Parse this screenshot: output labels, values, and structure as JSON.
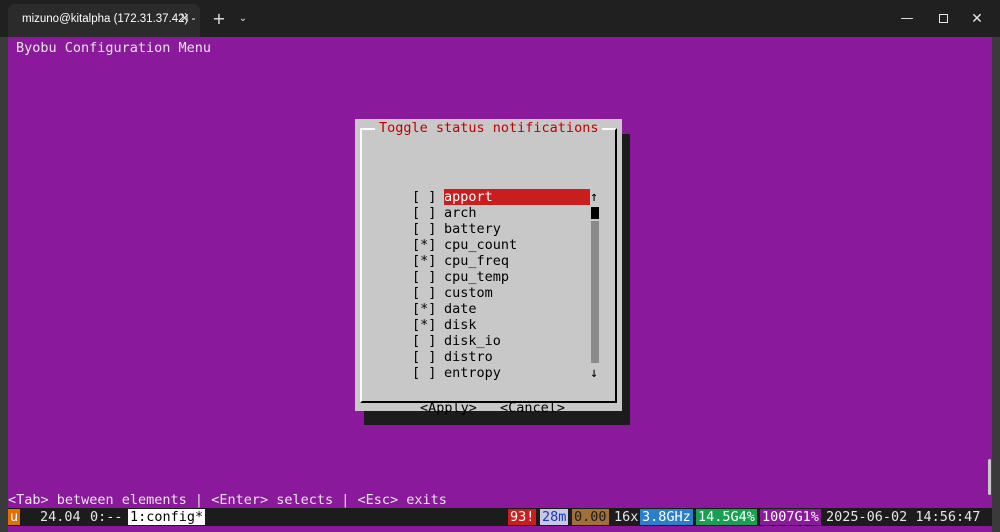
{
  "window": {
    "tab_title": "mizuno@kitalpha (172.31.37.42) -",
    "tab_close_icon": "×",
    "new_tab_icon": "+",
    "dropdown_icon": "⌄",
    "minimize_icon": "—",
    "close_icon": "✕"
  },
  "terminal": {
    "menu_title": "Byobu Configuration Menu",
    "dialog": {
      "title": "Toggle status notifications",
      "items": [
        {
          "check": "[ ]",
          "label": "apport",
          "selected": true
        },
        {
          "check": "[ ]",
          "label": "arch"
        },
        {
          "check": "[ ]",
          "label": "battery"
        },
        {
          "check": "[*]",
          "label": "cpu_count"
        },
        {
          "check": "[*]",
          "label": "cpu_freq"
        },
        {
          "check": "[ ]",
          "label": "cpu_temp"
        },
        {
          "check": "[ ]",
          "label": "custom"
        },
        {
          "check": "[*]",
          "label": "date"
        },
        {
          "check": "[*]",
          "label": "disk"
        },
        {
          "check": "[ ]",
          "label": "disk_io"
        },
        {
          "check": "[ ]",
          "label": "distro"
        },
        {
          "check": "[ ]",
          "label": "entropy"
        }
      ],
      "scroll_up": "↑",
      "scroll_down": "↓",
      "apply_label": "<Apply>",
      "cancel_label": "<Cancel>"
    },
    "help_line": "<Tab> between elements | <Enter> selects | <Esc> exits"
  },
  "statusbar": {
    "segments": [
      {
        "text": "u",
        "bg": "#e07000",
        "fg": "#ffffff"
      },
      {
        "text": "24.04",
        "bg": "#1c1c1c",
        "fg": "#e6e6e6"
      },
      {
        "text": "0:--",
        "bg": "#1c1c1c",
        "fg": "#e6e6e6"
      },
      {
        "text": "1:config*",
        "bg": "#ffffff",
        "fg": "#000000"
      },
      {
        "text": "93!",
        "bg": "#c81e1e",
        "fg": "#ffffff"
      },
      {
        "text": "28m",
        "bg": "#c8c8e6",
        "fg": "#1a3ab0"
      },
      {
        "text": "0.00",
        "bg": "#a0703a",
        "fg": "#1c1c1c"
      },
      {
        "text": "16x",
        "bg": "#1c1c1c",
        "fg": "#e6e6e6"
      },
      {
        "text": "3.8GHz",
        "bg": "#2a7fc8",
        "fg": "#ffffff"
      },
      {
        "text": "14.5G4%",
        "bg": "#18a050",
        "fg": "#ffffff"
      },
      {
        "text": "1007G1%",
        "bg": "#8a1a9b",
        "fg": "#ffffff"
      },
      {
        "text": "2025-06-02 14:56:47",
        "bg": "#1c1c1c",
        "fg": "#e6e6e6"
      }
    ]
  }
}
